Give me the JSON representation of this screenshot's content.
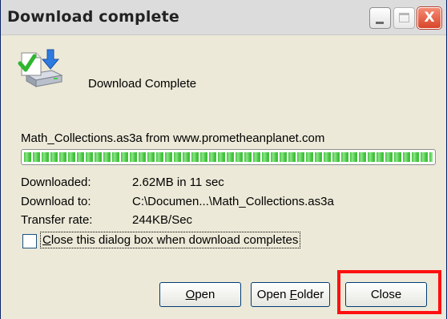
{
  "window": {
    "title": "Download complete",
    "close_glyph": "X"
  },
  "heading": "Download Complete",
  "icon": "download-complete-icon",
  "source": "Math_Collections.as3a from www.prometheanplanet.com",
  "progress": {
    "fraction": 1.0
  },
  "info": {
    "downloaded_label": "Downloaded:",
    "downloaded_value": "2.62MB in 11 sec",
    "download_to_label": "Download to:",
    "download_to_value": "C:\\Documen...\\Math_Collections.as3a",
    "transfer_rate_label": "Transfer rate:",
    "transfer_rate_value": "244KB/Sec"
  },
  "checkbox": {
    "checked": false,
    "label_first": "C",
    "label_rest": "lose this dialog box when download completes"
  },
  "buttons": {
    "open_first": "O",
    "open_rest": "pen",
    "open_folder_pre": "Open ",
    "open_folder_key": "F",
    "open_folder_post": "older",
    "close": "Close"
  },
  "colors": {
    "highlight": "#ff1010",
    "progress": "#3fc23a"
  }
}
